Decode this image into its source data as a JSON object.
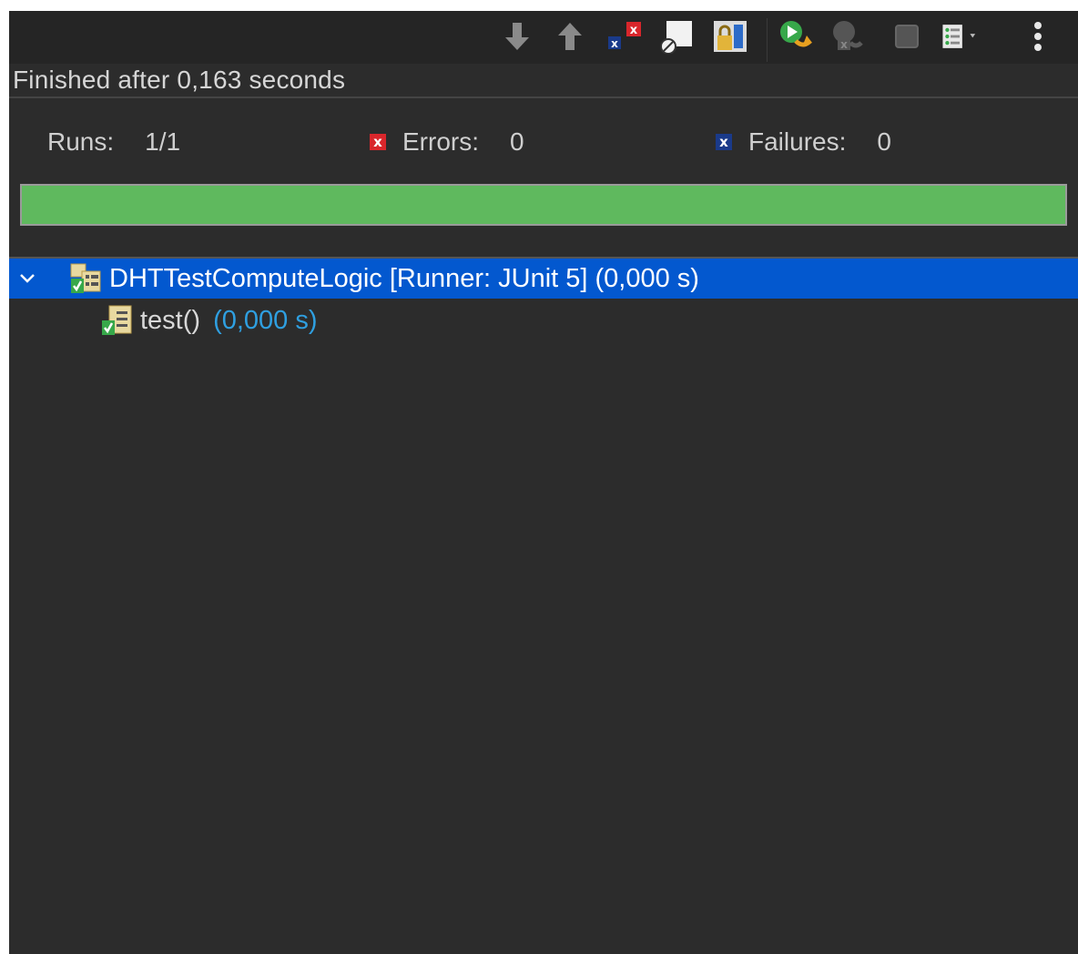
{
  "status": {
    "text": "Finished after 0,163 seconds"
  },
  "counters": {
    "runs_label": "Runs:",
    "runs_value": "1/1",
    "errors_label": "Errors:",
    "errors_value": "0",
    "failures_label": "Failures:",
    "failures_value": "0"
  },
  "progress": {
    "fraction": 1.0,
    "color": "#5fb95e"
  },
  "tree": {
    "root": {
      "label": "DHTTestComputeLogic [Runner: JUnit 5] (0,000 s)"
    },
    "children": [
      {
        "label": "test()",
        "duration": "(0,000 s)"
      }
    ]
  },
  "toolbar": {
    "icons": [
      "next-failure-icon",
      "previous-failure-icon",
      "show-failures-only-icon",
      "show-skipped-icon",
      "scroll-lock-icon",
      "rerun-test-icon",
      "rerun-failures-first-icon",
      "stop-icon",
      "test-run-history-icon",
      "view-menu-icon"
    ]
  },
  "colors": {
    "panel_bg": "#2c2c2c",
    "selection": "#0358cf",
    "error_badge": "#d9262b",
    "failure_badge": "#1a3a8a",
    "duration_text": "#2f9fe0"
  }
}
